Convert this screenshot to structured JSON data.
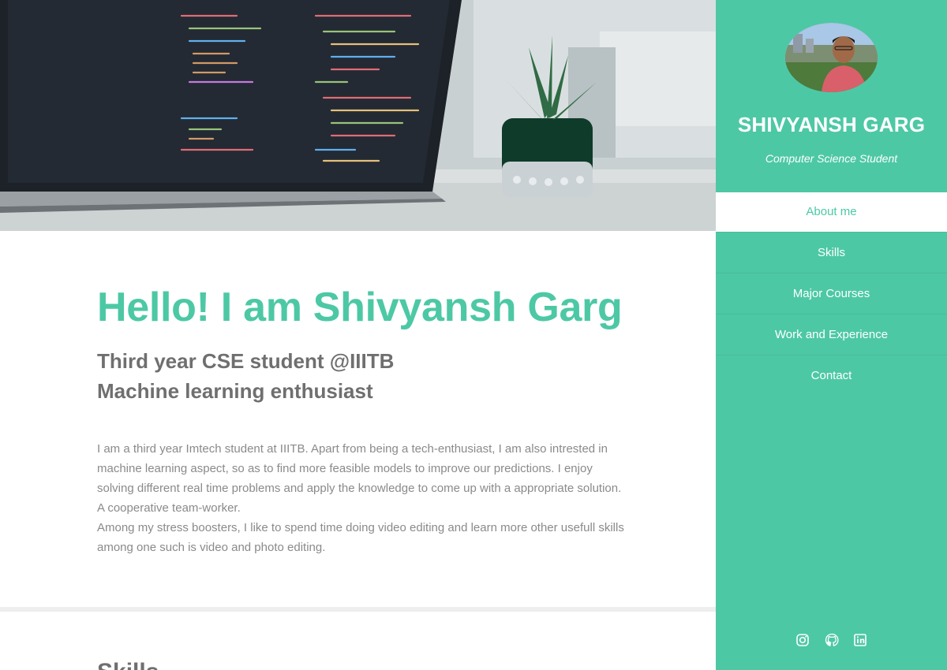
{
  "sidebar": {
    "name": "SHIVYANSH GARG",
    "role": "Computer Science Student",
    "nav": [
      {
        "label": "About me",
        "active": true
      },
      {
        "label": "Skills",
        "active": false
      },
      {
        "label": "Major Courses",
        "active": false
      },
      {
        "label": "Work and Experience",
        "active": false
      },
      {
        "label": "Contact",
        "active": false
      }
    ],
    "social_icons": [
      "instagram-icon",
      "github-icon",
      "linkedin-icon"
    ]
  },
  "about": {
    "heading": "Hello! I am Shivyansh Garg",
    "subheading_1": "Third year CSE student @IIITB",
    "subheading_2": "Machine learning enthusiast",
    "paragraph_1": "I am a third year Imtech student at IIITB. Apart from being a tech-enthusiast, I am also intrested in machine learning aspect, so as to find more feasible models to improve our predictions. I enjoy solving different real time problems and apply the knowledge to come up with a appropriate solution. A cooperative team-worker.",
    "paragraph_2": "Among my stress boosters, I like to spend time doing video editing and learn more other usefull skills among one such is video and photo editing."
  },
  "next_section": {
    "heading": "Skills"
  },
  "colors": {
    "accent": "#4dc8a5",
    "text_muted": "#8a8a8a",
    "subheading": "#6f6f6f"
  }
}
